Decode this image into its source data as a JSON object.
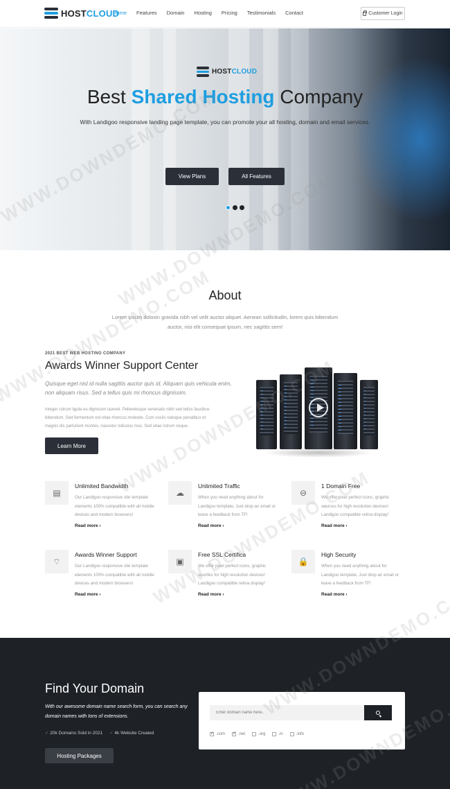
{
  "nav": {
    "brand": {
      "main": "HOST",
      "accent": "CLOUD"
    },
    "items": [
      {
        "label": "Home",
        "active": true
      },
      {
        "label": "Features",
        "active": false
      },
      {
        "label": "Domain",
        "active": false
      },
      {
        "label": "Hosting",
        "active": false
      },
      {
        "label": "Pricing",
        "active": false
      },
      {
        "label": "Testimonials",
        "active": false
      },
      {
        "label": "Contact",
        "active": false
      }
    ],
    "login": "Customer Login"
  },
  "hero": {
    "brand": {
      "main": "HOST",
      "accent": "CLOUD"
    },
    "title_pre": "Best ",
    "title_hl": "Shared Hosting",
    "title_post": " Company",
    "subtitle": "With Landigoo responsive landing page template, you can promote your all hosting, domain and email services.",
    "btn_plans": "View Plans",
    "btn_features": "All Features",
    "slides": 3,
    "active_slide": 1
  },
  "about": {
    "title": "About",
    "text": "Lorem ipsum dolosin gravida nibh vel velit auctor aliquet. Aenean sollicitudin, lorem quis bibendum auctor, nisi elit consequat ipsum, nec sagittis sem!",
    "kicker": "2021 BEST WEB HOSTING COMPANY",
    "award_title": "Awards Winner Support Center",
    "award_lead": "Quisque eget nisl id nulla sagittis auctor quis id. Aliquam quis vehicula enim, non aliquam risus. Sed a tellus quis mi rhoncus dignissim.",
    "award_body": "Integer rutrum ligula eu dignissim laoreet. Pellentesque venenatis nibh sed tellus faucibus bibendum. Sed fermentum est vitae rhoncus molestie. Cum sociis natoque penatibus et magnis dis parturient montes, nascetur ridiculus mus. Sed vitae rutrum neque.",
    "learn_more": "Learn More"
  },
  "features": [
    {
      "title": "Unlimited Bandwidth",
      "icon": "server-icon",
      "glyph": "▤",
      "text": "Our Landigoo responsive site template elements 100% compatible with all mobile devices and modern browsers!",
      "more": "Read more ›"
    },
    {
      "title": "Unlimited Traffic",
      "icon": "cloud-icon",
      "glyph": "☁",
      "text": "When you need anything about for Landigoo template, Just drop an email or leave a feedback from TF!",
      "more": "Read more ›"
    },
    {
      "title": "1 Domain Free",
      "icon": "router-icon",
      "glyph": "⊖",
      "text": "We offer pixel perfect icons, graphic sources for high resolution devices! Landigoo compatible retina display!",
      "more": "Read more ›"
    },
    {
      "title": "Awards Winner Support",
      "icon": "wifi-icon",
      "glyph": "⌔",
      "text": "Our Landigoo responsive site template elements 100% compatible with all mobile devices and modern browsers!",
      "more": "Read more ›"
    },
    {
      "title": "Free SSL Certifica",
      "icon": "certificate-icon",
      "glyph": "▣",
      "text": "We offer pixel perfect icons, graphic sources for high resolution devices! Landigoo compatible retina display!",
      "more": "Read more ›"
    },
    {
      "title": "High Security",
      "icon": "lock-icon",
      "glyph": "🔒",
      "text": "When you need anything about for Landigoo template, Just drop an email or leave a feedback from TF!",
      "more": "Read more ›"
    }
  ],
  "domain": {
    "title": "Find Your Domain",
    "text": "With our awesome domain name search form, you can search any domain names with tons of extensions.",
    "stats": [
      "20k Domains Sold in 2021",
      "4k Website Created"
    ],
    "button": "Hosting Packages",
    "placeholder": "Enter domain name here..",
    "tlds": [
      {
        "label": ".com",
        "checked": true
      },
      {
        "label": ".net",
        "checked": true
      },
      {
        "label": ".org",
        "checked": false
      },
      {
        "label": ".in",
        "checked": false
      },
      {
        "label": ".info",
        "checked": false
      }
    ]
  },
  "watermark": "WWW.DOWNDEMO.COM",
  "colors": {
    "accent": "#1e9ee0",
    "dark": "#2a2f38",
    "footer": "#1e2126"
  }
}
